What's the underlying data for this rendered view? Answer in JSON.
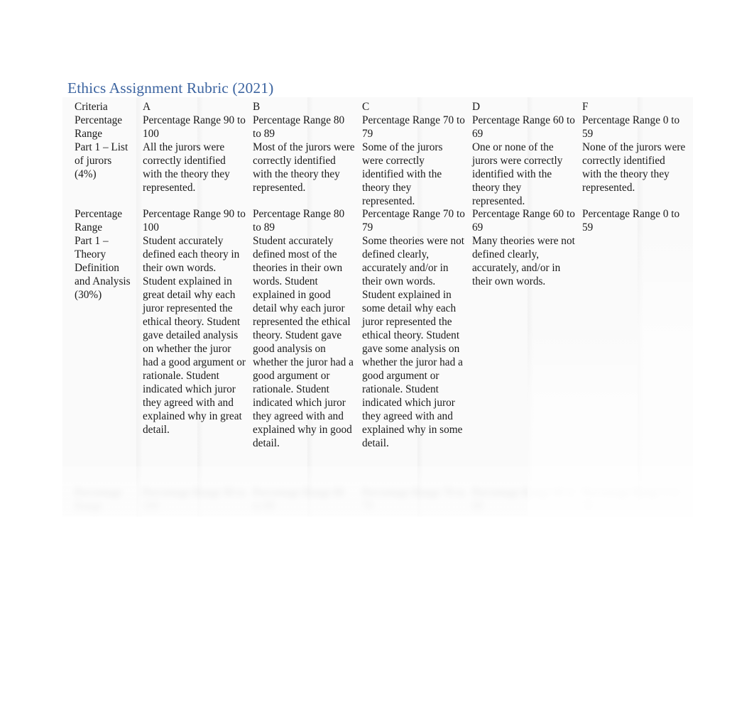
{
  "document": {
    "title": "Ethics Assignment Rubric (2021)",
    "title_color": "#3c64a0"
  },
  "table": {
    "columns": [
      {
        "key": "criteria",
        "header": "Criteria"
      },
      {
        "key": "a",
        "header": "A"
      },
      {
        "key": "b",
        "header": "B"
      },
      {
        "key": "c",
        "header": "C"
      },
      {
        "key": "d",
        "header": "D"
      },
      {
        "key": "f",
        "header": "F"
      }
    ],
    "rows": [
      {
        "name": "part-1-list-of-jurors",
        "visible": true,
        "criteria_line1": "Percentage Range",
        "criteria_line2": "Part 1 – List of jurors (4%)",
        "cells": [
          {
            "range": "Percentage Range 90 to 100",
            "text": "All the jurors were correctly identified with the theory they represented."
          },
          {
            "range": "Percentage Range 80 to 89",
            "text": "Most of the jurors were correctly identified with the theory they represented."
          },
          {
            "range": "Percentage Range 70 to 79",
            "text": "Some of the jurors were correctly identified with the theory they represented."
          },
          {
            "range": "Percentage Range 60 to 69",
            "text": "One or none of the jurors were correctly identified with the theory they represented."
          },
          {
            "range": "Percentage Range 0 to 59",
            "text": "None of the jurors were correctly identified with the theory they represented."
          }
        ]
      },
      {
        "name": "part-1-theory-definition-and-analysis",
        "visible": true,
        "criteria_line1": "Percentage Range",
        "criteria_line2": "Part 1 – Theory Definition and Analysis (30%)",
        "cells": [
          {
            "range": "Percentage Range 90 to 100",
            "text": "Student accurately defined each theory in their own words. Student explained in great detail why each juror represented the ethical theory. Student gave detailed analysis on whether the juror had a good argument or rationale. Student indicated which juror they agreed with and explained why in great detail."
          },
          {
            "range": "Percentage Range 80 to 89",
            "text": "Student accurately defined most of the theories in their own words. Student explained in good detail why each juror represented the ethical theory. Student gave good analysis on whether the juror had a good argument or rationale. Student indicated which juror they agreed with and explained why in good detail."
          },
          {
            "range": "Percentage Range 70 to 79",
            "text": "Some theories were not defined clearly, accurately and/or in their own words. Student explained in some detail why each juror represented the ethical theory. Student gave some analysis on whether the juror had a good argument or rationale. Student indicated which juror they agreed with and explained why in some detail."
          },
          {
            "range": "Percentage Range 60 to 69",
            "text": "Many theories were not defined clearly, accurately, and/or in their own words."
          },
          {
            "range": "Percentage Range 0 to 59",
            "text": ""
          }
        ]
      },
      {
        "name": "next-criterion-faded",
        "visible": false,
        "criteria_line1": "Percentage Range",
        "criteria_line2": "",
        "cells": [
          {
            "range": "Percentage Range 90 to 100",
            "text": ""
          },
          {
            "range": "Percentage Range 80 to 89",
            "text": ""
          },
          {
            "range": "Percentage Range 70 to 79",
            "text": ""
          },
          {
            "range": "Percentage Range 60 to 69",
            "text": ""
          },
          {
            "range": "Percentage Range 0 to 59",
            "text": ""
          }
        ]
      }
    ]
  }
}
